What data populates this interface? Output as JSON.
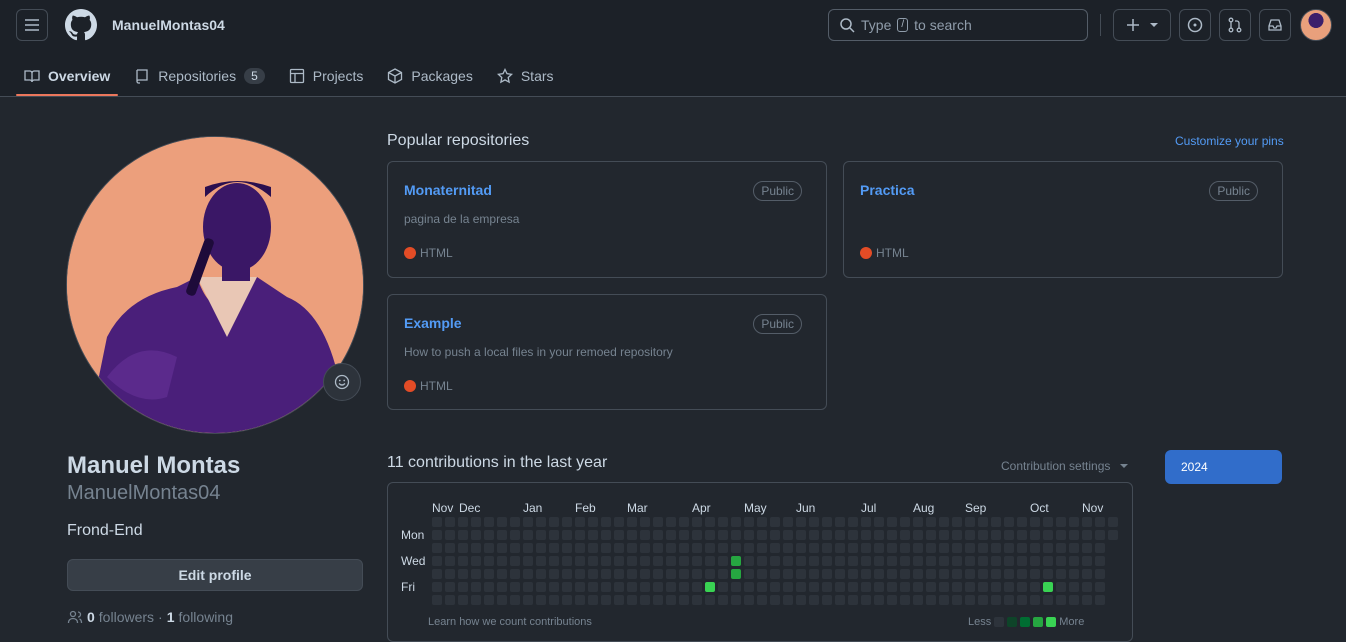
{
  "header": {
    "username": "ManuelMontas04",
    "search_prefix": "Type",
    "search_key": "/",
    "search_suffix": "to search"
  },
  "tabs": [
    {
      "label": "Overview",
      "active": true
    },
    {
      "label": "Repositories",
      "count": "5"
    },
    {
      "label": "Projects"
    },
    {
      "label": "Packages"
    },
    {
      "label": "Stars"
    }
  ],
  "profile": {
    "name": "Manuel Montas",
    "login": "ManuelMontas04",
    "bio": "Frond-End",
    "edit_label": "Edit profile",
    "followers_count": "0",
    "followers_label": "followers",
    "following_count": "1",
    "following_label": "following"
  },
  "pinned": {
    "title": "Popular repositories",
    "customize_label": "Customize your pins",
    "repos": [
      {
        "name": "Monaternitad",
        "visibility": "Public",
        "description": "pagina de la empresa",
        "language": "HTML"
      },
      {
        "name": "Practica",
        "visibility": "Public",
        "description": "",
        "language": "HTML"
      },
      {
        "name": "Example",
        "visibility": "Public",
        "description": "How to push a local files in your remoed repository",
        "language": "HTML"
      }
    ]
  },
  "contributions": {
    "title": "11 contributions in the last year",
    "settings_label": "Contribution settings",
    "year": "2024",
    "months": [
      "Nov",
      "Dec",
      "Jan",
      "Feb",
      "Mar",
      "Apr",
      "May",
      "Jun",
      "Jul",
      "Aug",
      "Sep",
      "Oct",
      "Nov"
    ],
    "days": [
      "Mon",
      "Wed",
      "Fri"
    ],
    "learn_label": "Learn how we count contributions",
    "less_label": "Less",
    "more_label": "More",
    "active_cells": [
      {
        "week": 21,
        "day": 5,
        "level": 3
      },
      {
        "week": 23,
        "day": 3,
        "level": 2
      },
      {
        "week": 23,
        "day": 4,
        "level": 2
      },
      {
        "week": 47,
        "day": 5,
        "level": 3
      }
    ]
  },
  "colors": {
    "accent": "#539bf5",
    "tab_underline": "#ec775c",
    "html_lang": "#e34c26",
    "levels": [
      "#2d333b",
      "#0e4429",
      "#006d32",
      "#26a641",
      "#39d353"
    ]
  }
}
